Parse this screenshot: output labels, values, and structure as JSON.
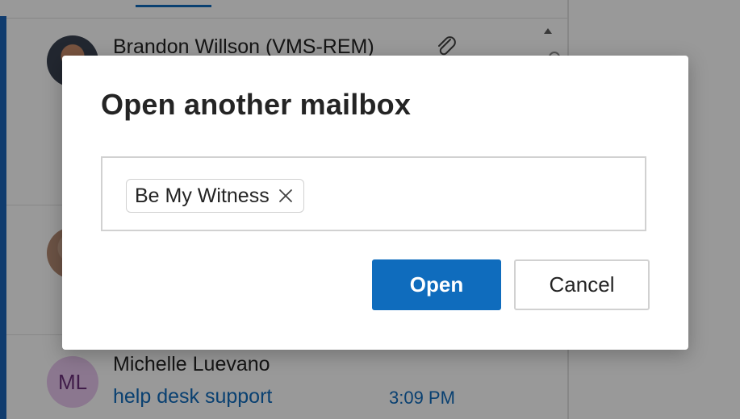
{
  "background": {
    "messages": [
      {
        "sender": "Brandon Willson (VMS-REM)",
        "has_attachment": true
      },
      {
        "sender": "",
        "has_attachment": false
      },
      {
        "sender": "Michelle Luevano",
        "avatar_initials": "ML",
        "subject": "help desk support",
        "time": "3:09 PM"
      }
    ]
  },
  "dialog": {
    "title": "Open another mailbox",
    "selected_mailbox": "Be My Witness",
    "open_label": "Open",
    "cancel_label": "Cancel"
  },
  "colors": {
    "accent": "#0f6cbd",
    "avatar_ml_bg": "#e8c6ee"
  },
  "icons": {
    "chip_remove": "close-icon",
    "attachment": "paperclip-icon"
  }
}
